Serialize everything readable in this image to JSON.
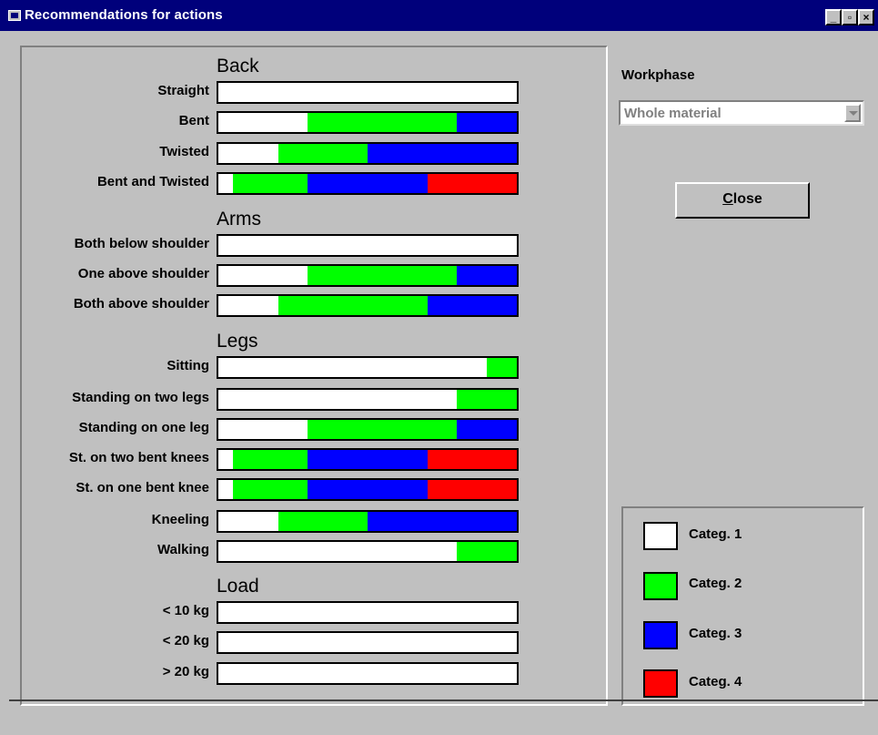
{
  "window": {
    "title": "Recommendations for actions",
    "minimize": "_",
    "maximize": "▫",
    "close": "×"
  },
  "sections": {
    "back": "Back",
    "arms": "Arms",
    "legs": "Legs",
    "load": "Load"
  },
  "colors": {
    "categ1": "#ffffff",
    "categ2": "#00ff00",
    "categ3": "#0000ff",
    "categ4": "#ff0000",
    "background": "#c0c0c0",
    "titlebar": "#00007b"
  },
  "rows": [
    {
      "label": "Straight",
      "fractions": [
        1,
        0,
        0,
        0
      ]
    },
    {
      "label": "Bent",
      "fractions": [
        0.3,
        0.5,
        0.2,
        0
      ]
    },
    {
      "label": "Twisted",
      "fractions": [
        0.2,
        0.3,
        0.5,
        0
      ]
    },
    {
      "label": "Bent and Twisted",
      "fractions": [
        0.05,
        0.25,
        0.4,
        0.3
      ]
    },
    {
      "label": "Both below shoulder",
      "fractions": [
        1,
        0,
        0,
        0
      ]
    },
    {
      "label": "One above shoulder",
      "fractions": [
        0.3,
        0.5,
        0.2,
        0
      ]
    },
    {
      "label": "Both above shoulder",
      "fractions": [
        0.2,
        0.5,
        0.3,
        0
      ]
    },
    {
      "label": "Sitting",
      "fractions": [
        0.9,
        0.1,
        0,
        0
      ]
    },
    {
      "label": "Standing on two legs",
      "fractions": [
        0.8,
        0.2,
        0,
        0
      ]
    },
    {
      "label": "Standing on one leg",
      "fractions": [
        0.3,
        0.5,
        0.2,
        0
      ]
    },
    {
      "label": "St. on two bent knees",
      "fractions": [
        0.05,
        0.25,
        0.4,
        0.3
      ]
    },
    {
      "label": "St. on one bent knee",
      "fractions": [
        0.05,
        0.25,
        0.4,
        0.3
      ]
    },
    {
      "label": "Kneeling",
      "fractions": [
        0.2,
        0.3,
        0.5,
        0
      ]
    },
    {
      "label": "Walking",
      "fractions": [
        0.8,
        0.2,
        0,
        0
      ]
    },
    {
      "label": "< 10 kg",
      "fractions": [
        1,
        0,
        0,
        0
      ]
    },
    {
      "label": "< 20 kg",
      "fractions": [
        1,
        0,
        0,
        0
      ]
    },
    {
      "label": "> 20 kg",
      "fractions": [
        1,
        0,
        0,
        0
      ]
    }
  ],
  "workphase": {
    "label": "Workphase",
    "value": "Whole material"
  },
  "close_button": {
    "mnemonic": "C",
    "rest": "lose"
  },
  "legend": [
    {
      "label": "Categ. 1",
      "color": "#ffffff"
    },
    {
      "label": "Categ. 2",
      "color": "#00ff00"
    },
    {
      "label": "Categ. 3",
      "color": "#0000ff"
    },
    {
      "label": "Categ. 4",
      "color": "#ff0000"
    }
  ]
}
